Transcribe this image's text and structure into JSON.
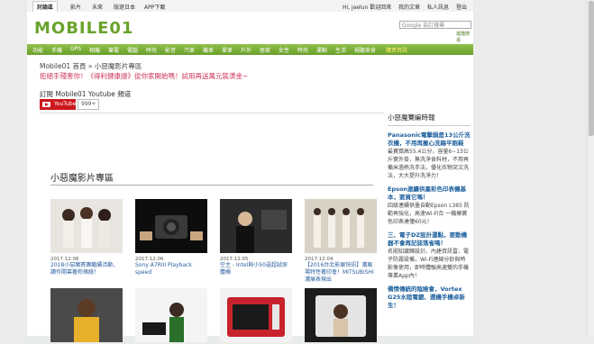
{
  "topbar": {
    "tabs": [
      "討論區",
      "影片",
      "未來",
      "版遊日本",
      "APP下載"
    ],
    "user": "Hi, jaelun 歡迎回來",
    "links": [
      "我的文章",
      "私人訊息",
      "登出"
    ]
  },
  "header": {
    "logo": "MOBILE01",
    "search_placeholder": "Google 自訂搜尋",
    "advanced": "進階搜尋"
  },
  "nav": [
    "功能",
    "手機",
    "GPS",
    "相機",
    "筆電",
    "電腦",
    "時尚",
    "影音",
    "汽車",
    "機車",
    "單車",
    "戶外",
    "居家",
    "女性",
    "時尚",
    "運動",
    "生活",
    "視聽美食",
    "購買資訊"
  ],
  "breadcrumb": "Mobile01 首頁 » 小惡魔影片專區",
  "promo": "拒絕手殘害你！《得利健康證》從你家開始嗎！試用再送萬元裝潢金~",
  "subscribe": "訂閱 Mobile01 Youtube 頻道",
  "youtube": {
    "label": "YouTube",
    "count": "999+"
  },
  "section_title": "小惡魔影片專區",
  "videos": [
    {
      "date": "2017.12.06",
      "caption": "2018小惡魔賓團繼續活動，讀作開幕著棕褚絡！"
    },
    {
      "date": "2017.12.06",
      "caption": "Sony A7RIII Playback speed"
    },
    {
      "date": "2017.12.05",
      "caption": "空主 - Intel與小50逞超試探體揮"
    },
    {
      "date": "2017.12.04",
      "caption": "【2016台北影展快訊】濃展場特性著印會！MITSUBISHI 濃展表現出"
    }
  ],
  "sidebar": {
    "title": "小惡魔賽編時報",
    "articles": [
      {
        "head": "Panasonic電擊鍋是13公斤洗衣機，不用再搬心洗踢平跑鞋",
        "text": "最寶窩高55.4公分，容量6~13公斤實外掛，無洗淨食料材，不用再備米過熱洗手法，優化衣物突文洗法，大大提升洗淨力！"
      },
      {
        "head": "Epson連續供墨彩色印表機基本，要買它嗎！",
        "text": "四級連續供墨自動Epson L385 防範再強化，高速Wi-Fi合 一機擁寶色印表達僅60元！"
      },
      {
        "head": "三、電子DZ設計還點，要動機器不會再記誌落雀嗎！",
        "text": "名闖知識歸設計、內建資訊雷、電子防霧設備，Wi-Fi連線分鈔與時影像使用，即時體驗高速雙的手機專業App內！"
      },
      {
        "head": "備情傳統的陰險會，Vortex G25水陸電鍍、選機手機卓新生！",
        "text": ""
      }
    ]
  },
  "colors": {
    "brand_green": "#6aa32b",
    "nav_green": "#7fb33a",
    "link_blue": "#2a5ea0",
    "youtube_red": "#cc181e",
    "promo_red": "#cc3355"
  }
}
